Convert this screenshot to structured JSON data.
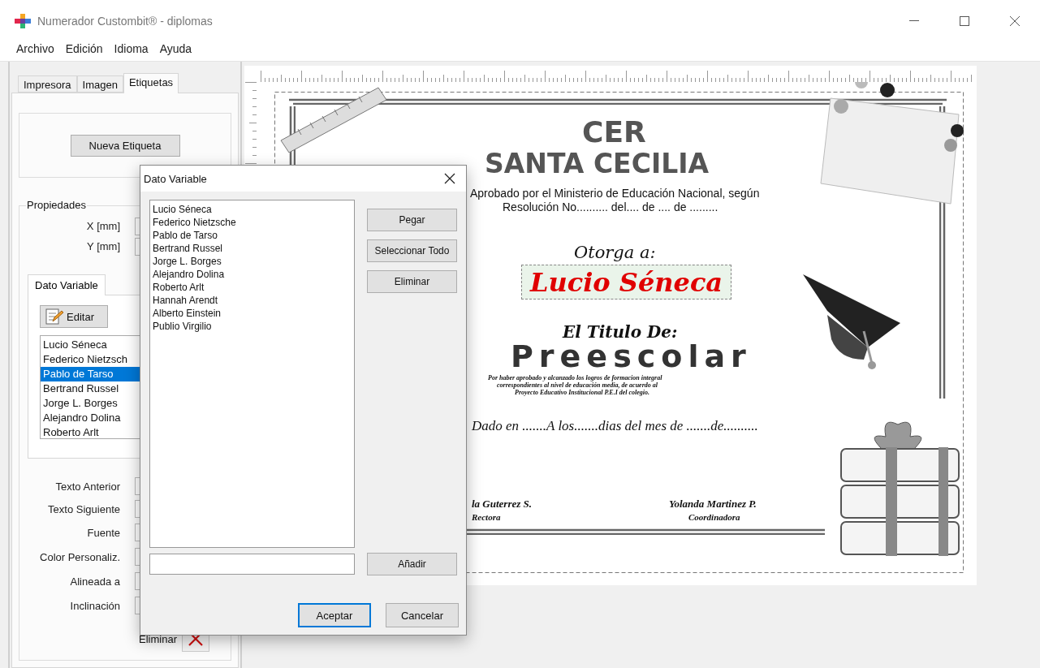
{
  "window": {
    "title": "Numerador Custombit® - diplomas"
  },
  "menu": [
    "Archivo",
    "Edición",
    "Idioma",
    "Ayuda"
  ],
  "side_tabs": [
    {
      "label": "Impresora",
      "selected": false
    },
    {
      "label": "Imagen",
      "selected": false
    },
    {
      "label": "Etiquetas",
      "selected": true
    }
  ],
  "new_label_button": "Nueva Etiqueta",
  "properties": {
    "title": "Propiedades",
    "position_fields": [
      "X [mm]",
      "Y [mm]"
    ],
    "inner_tabs": [
      {
        "label": "Dato Variable",
        "selected": true
      }
    ],
    "edit_button": "Editar",
    "values": [
      {
        "text": "Lucio Séneca",
        "selected": false
      },
      {
        "text": "Federico Nietzsch",
        "selected": false
      },
      {
        "text": "Pablo de Tarso",
        "selected": true
      },
      {
        "text": "Bertrand Russel",
        "selected": false
      },
      {
        "text": "Jorge L. Borges",
        "selected": false
      },
      {
        "text": "Alejandro Dolina",
        "selected": false
      },
      {
        "text": "Roberto Arlt",
        "selected": false
      }
    ],
    "fields": [
      "Texto Anterior",
      "Texto Siguiente",
      "Fuente",
      "Color Personaliz.",
      "Alineada a",
      "Inclinación"
    ],
    "delete_label": "Eliminar"
  },
  "certificate": {
    "school_line_1": "CER",
    "school_line_2": "SANTA CECILIA",
    "approval_lines": [
      "Aprobado por el Ministerio de Educación Nacional, según",
      "Resolución No.......... del.... de .... de ........."
    ],
    "grant_heading": "Otorga a:",
    "recipient": {
      "text": "Lucio Séneca",
      "selected": true
    },
    "title_heading": "El Titulo De:",
    "degree": "Preescolar",
    "reason_lines": [
      "Por haber aprobado y alcanzado los logros de formacion integral",
      "correspondientes al nivel de educación media, de acuerdo al",
      "Proyecto Educativo Institucional P.E.I del colegio."
    ],
    "date_line": "Dado en .......A los.......dias del mes de .......de..........",
    "signatures": [
      {
        "name": "la Guterrez S.",
        "role": "Rectora"
      },
      {
        "name": "Yolanda Martinez P.",
        "role": "Coordinadora"
      }
    ]
  },
  "dialog": {
    "title": "Dato Variable",
    "items": [
      "Lucio Séneca",
      "Federico Nietzsche",
      "Pablo de Tarso",
      "Bertrand Russel",
      "Jorge L. Borges",
      "Alejandro Dolina",
      "Roberto Arlt",
      "Hannah Arendt",
      "Alberto Einstein",
      "Publio Virgilio"
    ],
    "side_buttons": [
      "Pegar",
      "Seleccionar Todo",
      "Eliminar"
    ],
    "add_button": "Añadir",
    "footer_buttons": [
      {
        "label": "Aceptar",
        "default": true
      },
      {
        "label": "Cancelar",
        "default": false
      }
    ]
  }
}
